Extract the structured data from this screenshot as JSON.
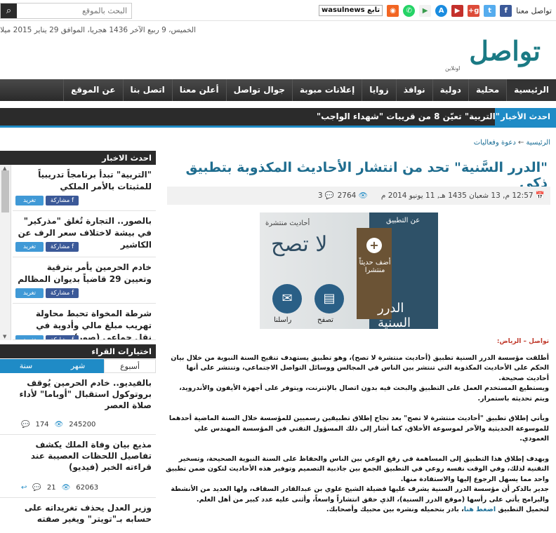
{
  "search": {
    "placeholder": "البحث بالموقع"
  },
  "social": {
    "label": "تواصل معنا",
    "handle": "wasulnews",
    "handle_prefix": "تابع"
  },
  "date": "الخميس، 9 ربيع الآخر 1436 هجريا، الموافق 29 يناير 2015 ميلاديا",
  "logo": {
    "text": "تواصل",
    "sub": "اونلاين"
  },
  "nav": [
    "الرئيسية",
    "محلية",
    "دولية",
    "نوافذ",
    "زوايا",
    "إعلانات مبوبة",
    "جوال تواصل",
    "أعلن معنا",
    "اتصل بنا",
    "عن الموقع"
  ],
  "ticker": {
    "label": "احدث الأخبار",
    "text": "\"التربية\" تعيّن 8 من قريبات \"شهداء الواجب\""
  },
  "breadcrumb": {
    "home": "الرئيسية",
    "sep": "←",
    "section": "دعوة وفعاليات"
  },
  "article": {
    "title": "\"الدرر السَّنية\" تحد من انتشار الأحاديث المكذوبة بتطبيق ذكي",
    "date": "12:57 م, 13 شعبان 1435 هـ, 11 يونيو 2014 م",
    "views": "2764",
    "comments": "3",
    "source": "تواصل – الرياض:",
    "paragraphs": [
      "أطلقت مؤسسة الدرر السنية تطبيق (أحاديث منتشرة لا تصح)، وهو تطبيق يستهدف تنقيح السنة النبوية من خلال بيان الحكم على الأحاديث المكذوبة التي تنتشر بين الناس في المجالس ووسائل التواصل الاجتماعي، وتنتشر على أنها أحاديث صحيحة.",
      "ويستطيع المستخدم العمل على التطبيق والبحث فيه بدون اتصال بالإنترنت، ويتوفر على أجهزة الأيفون والأندرويد، ويتم تحديثه باستمرار.",
      "ويأتي إطلاق تطبيق \"أحاديث منتشرة لا تصح\" بعد نجاح إطلاق تطبيقين رسميين للمؤسسة خلال السنة الماضية أحدهما للموسوعة الحديثية والآخر لموسوعة الأخلاق، كما أشار إلى ذلك المسؤول التقني في المؤسسة المهندس علي العمودي.",
      "ويهدف إطلاق هذا التطبيق إلى المساهمة في رفع الوعي بين الناس والحفاظ على السنة النبوية الصحيحة، وتسخير التقنية لذلك، وفي الوقت نفسه روعي في التطبيق الجمع بين جاذبية التصميم وتوفير هذه الأحاديث لتكون ضمن تطبيق واحد مما يسهل الرجوع إليها والاستفادة منها.",
      "جدير بالذكر أن مؤسسة الدرر السنية يشرف عليها فضيلة الشيخ علوي بن عبدالقادر السقاف، ولها العديد من الأنشطة والبرامج يأتي على رأسها (موقع الدرر السنية)، الذي حقق انتشاراً واسعاً، وأثنى عليه عدد كبير من أهل العلم."
    ],
    "download_prefix": "لتحميل التطبيق",
    "download_link": "اضغط هنا",
    "download_suffix": "، بادر بتحميله ونشره بين محبيك وأصحابك.",
    "image": {
      "t_top": "أحاديث منتشرة",
      "t_big": "لا تصح",
      "t_app": "عن التطبيق",
      "t_add": "أضف حديثاً منتشرا",
      "t_brand": "الدرر السنية",
      "btn1": "تصفح",
      "btn2": "راسلنا"
    }
  },
  "sidebar": {
    "latest_title": "احدث الاخبار",
    "share_tw": "تغريد",
    "share_fb": "مشاركة",
    "news": [
      "\"التربية\" تبدأ برنامجاً تدريبياً للمثبتات بالأمر الملكي",
      "بالصور.. التجارة تُغلق \"مذركير\" في بيشة لاختلاف سعر الرف عن الكاشير",
      "خادم الحرمين يأمر بترقية وتعيين 29 قاضياً بديوان المظالم",
      "شرطة المخواة تحبط محاولة تهريب مبلغ مالي وأدوية في نقل جماعي (صور)"
    ],
    "picks_title": "اختيارات القراء",
    "tabs": [
      "أسبوع",
      "شهر",
      "سنة"
    ],
    "picks": [
      {
        "text": "بالفيديو.. خادم الحرمين يُوقف بروتوكول استقبال \"أوباما\" لأداء صلاة العصر",
        "views": "245200",
        "comments": "174"
      },
      {
        "text": "مذيع بيان وفاة الملك يكشف تفاصيل اللحظات العصيبة عند قراءته الخبر (فيديو)",
        "views": "62063",
        "comments": "21"
      },
      {
        "text": "وزير العدل يحذف تغريداته على حسابه بـ\"تويتر\" ويغير صفته",
        "views": "",
        "comments": ""
      }
    ]
  },
  "colors": {
    "accent": "#1f8bc6",
    "nav": "#2b2b2b",
    "title": "#1f6d8f"
  }
}
